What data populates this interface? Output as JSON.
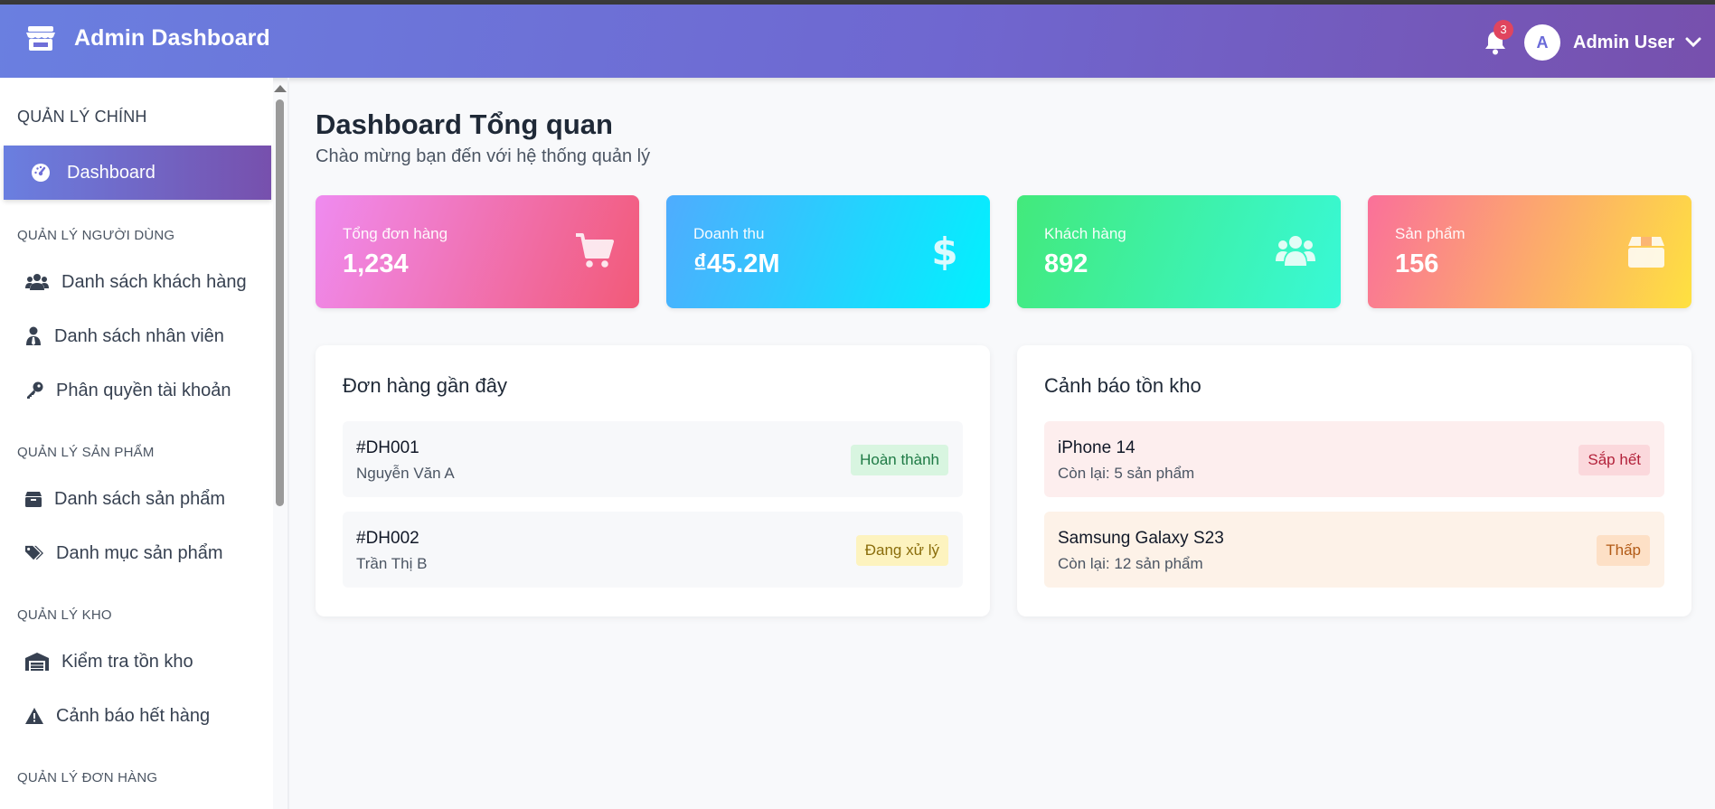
{
  "header": {
    "brand_icon": "store-icon",
    "title": "Admin Dashboard",
    "notifications_count": "3",
    "avatar_initial": "A",
    "user_name": "Admin User"
  },
  "sidebar": {
    "sections": [
      {
        "title": "QUẢN LÝ CHÍNH",
        "items": [
          {
            "label": "Dashboard",
            "icon": "gauge-icon",
            "active": true
          }
        ]
      },
      {
        "title": "QUẢN LÝ NGƯỜI DÙNG",
        "items": [
          {
            "label": "Danh sách khách hàng",
            "icon": "users-icon"
          },
          {
            "label": "Danh sách nhân viên",
            "icon": "user-tie-icon"
          },
          {
            "label": "Phân quyền tài khoản",
            "icon": "key-icon"
          }
        ]
      },
      {
        "title": "QUẢN LÝ SẢN PHẨM",
        "items": [
          {
            "label": "Danh sách sản phẩm",
            "icon": "box-icon"
          },
          {
            "label": "Danh mục sản phẩm",
            "icon": "tags-icon"
          }
        ]
      },
      {
        "title": "QUẢN LÝ KHO",
        "items": [
          {
            "label": "Kiểm tra tồn kho",
            "icon": "warehouse-icon"
          },
          {
            "label": "Cảnh báo hết hàng",
            "icon": "warning-icon"
          }
        ]
      },
      {
        "title": "QUẢN LÝ ĐƠN HÀNG",
        "items": []
      }
    ]
  },
  "main": {
    "title": "Dashboard Tổng quan",
    "subtitle": "Chào mừng bạn đến với hệ thống quản lý",
    "stats": [
      {
        "label": "Tổng đơn hàng",
        "value": "1,234",
        "icon": "cart-icon"
      },
      {
        "label": "Doanh thu",
        "value": "₫45.2M",
        "icon": "dollar-icon"
      },
      {
        "label": "Khách hàng",
        "value": "892",
        "icon": "users-icon"
      },
      {
        "label": "Sản phẩm",
        "value": "156",
        "icon": "box-icon"
      }
    ],
    "recent_orders": {
      "title": "Đơn hàng gần đây",
      "rows": [
        {
          "id": "#DH001",
          "customer": "Nguyễn Văn A",
          "status": "Hoàn thành",
          "status_color": "#1e7a45"
        },
        {
          "id": "#DH002",
          "customer": "Trần Thị B",
          "status": "Đang xử lý",
          "status_color": "#8a6d0b"
        }
      ]
    },
    "stock_alerts": {
      "title": "Cảnh báo tồn kho",
      "rows": [
        {
          "name": "iPhone 14",
          "remaining": "Còn lại: 5 sản phẩm",
          "level": "Sắp hết",
          "level_color": "#b3213a"
        },
        {
          "name": "Samsung Galaxy S23",
          "remaining": "Còn lại: 12 sản phẩm",
          "level": "Thấp",
          "level_color": "#b25a16"
        }
      ]
    }
  }
}
